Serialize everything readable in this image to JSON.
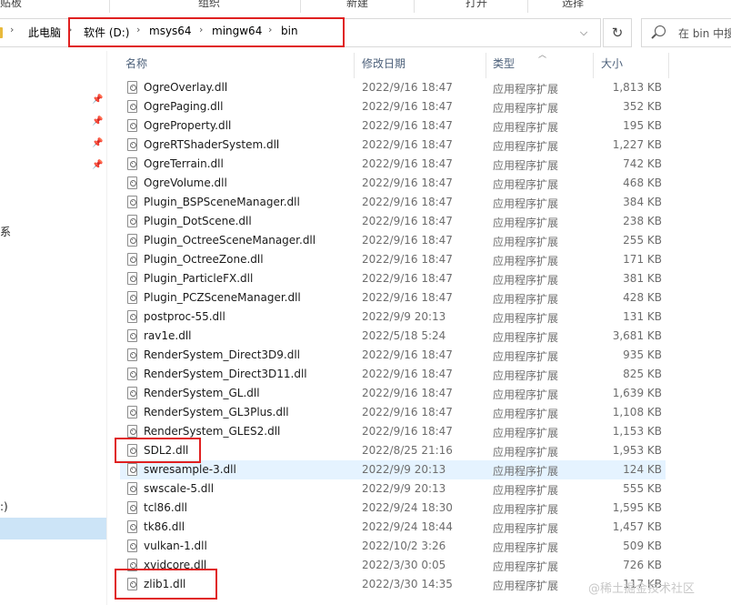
{
  "ribbon": {
    "items": [
      "贴板",
      "组织",
      "新建",
      "打开",
      "选择"
    ]
  },
  "address": {
    "crumbs": [
      "此电脑",
      "软件 (D:)",
      "msys64",
      "mingw64",
      "bin"
    ],
    "search_placeholder": "在 bin 中搜"
  },
  "nav": {
    "fragments": [
      "系",
      ":)"
    ]
  },
  "columns": {
    "name": "名称",
    "date": "修改日期",
    "type": "类型",
    "size": "大小"
  },
  "files": [
    {
      "name": "OgreOverlay.dll",
      "date": "2022/9/16 18:47",
      "type": "应用程序扩展",
      "size": "1,813 KB"
    },
    {
      "name": "OgrePaging.dll",
      "date": "2022/9/16 18:47",
      "type": "应用程序扩展",
      "size": "352 KB"
    },
    {
      "name": "OgreProperty.dll",
      "date": "2022/9/16 18:47",
      "type": "应用程序扩展",
      "size": "195 KB"
    },
    {
      "name": "OgreRTShaderSystem.dll",
      "date": "2022/9/16 18:47",
      "type": "应用程序扩展",
      "size": "1,227 KB"
    },
    {
      "name": "OgreTerrain.dll",
      "date": "2022/9/16 18:47",
      "type": "应用程序扩展",
      "size": "742 KB"
    },
    {
      "name": "OgreVolume.dll",
      "date": "2022/9/16 18:47",
      "type": "应用程序扩展",
      "size": "468 KB"
    },
    {
      "name": "Plugin_BSPSceneManager.dll",
      "date": "2022/9/16 18:47",
      "type": "应用程序扩展",
      "size": "384 KB"
    },
    {
      "name": "Plugin_DotScene.dll",
      "date": "2022/9/16 18:47",
      "type": "应用程序扩展",
      "size": "238 KB"
    },
    {
      "name": "Plugin_OctreeSceneManager.dll",
      "date": "2022/9/16 18:47",
      "type": "应用程序扩展",
      "size": "255 KB"
    },
    {
      "name": "Plugin_OctreeZone.dll",
      "date": "2022/9/16 18:47",
      "type": "应用程序扩展",
      "size": "171 KB"
    },
    {
      "name": "Plugin_ParticleFX.dll",
      "date": "2022/9/16 18:47",
      "type": "应用程序扩展",
      "size": "381 KB"
    },
    {
      "name": "Plugin_PCZSceneManager.dll",
      "date": "2022/9/16 18:47",
      "type": "应用程序扩展",
      "size": "428 KB"
    },
    {
      "name": "postproc-55.dll",
      "date": "2022/9/9 20:13",
      "type": "应用程序扩展",
      "size": "131 KB"
    },
    {
      "name": "rav1e.dll",
      "date": "2022/5/18 5:24",
      "type": "应用程序扩展",
      "size": "3,681 KB"
    },
    {
      "name": "RenderSystem_Direct3D9.dll",
      "date": "2022/9/16 18:47",
      "type": "应用程序扩展",
      "size": "935 KB"
    },
    {
      "name": "RenderSystem_Direct3D11.dll",
      "date": "2022/9/16 18:47",
      "type": "应用程序扩展",
      "size": "825 KB"
    },
    {
      "name": "RenderSystem_GL.dll",
      "date": "2022/9/16 18:47",
      "type": "应用程序扩展",
      "size": "1,639 KB"
    },
    {
      "name": "RenderSystem_GL3Plus.dll",
      "date": "2022/9/16 18:47",
      "type": "应用程序扩展",
      "size": "1,108 KB"
    },
    {
      "name": "RenderSystem_GLES2.dll",
      "date": "2022/9/16 18:47",
      "type": "应用程序扩展",
      "size": "1,153 KB"
    },
    {
      "name": "SDL2.dll",
      "date": "2022/8/25 21:16",
      "type": "应用程序扩展",
      "size": "1,953 KB"
    },
    {
      "name": "swresample-3.dll",
      "date": "2022/9/9 20:13",
      "type": "应用程序扩展",
      "size": "124 KB"
    },
    {
      "name": "swscale-5.dll",
      "date": "2022/9/9 20:13",
      "type": "应用程序扩展",
      "size": "555 KB"
    },
    {
      "name": "tcl86.dll",
      "date": "2022/9/24 18:30",
      "type": "应用程序扩展",
      "size": "1,595 KB"
    },
    {
      "name": "tk86.dll",
      "date": "2022/9/24 18:44",
      "type": "应用程序扩展",
      "size": "1,457 KB"
    },
    {
      "name": "vulkan-1.dll",
      "date": "2022/10/2 3:26",
      "type": "应用程序扩展",
      "size": "509 KB"
    },
    {
      "name": "xvidcore.dll",
      "date": "2022/3/30 0:05",
      "type": "应用程序扩展",
      "size": "726 KB"
    },
    {
      "name": "zlib1.dll",
      "date": "2022/3/30 14:35",
      "type": "应用程序扩展",
      "size": "117 KB"
    }
  ],
  "watermark": "@稀土掘金技术社区",
  "colors": {
    "highlight_border": "#e02020",
    "hover_row": "#e5f3ff",
    "nav_selected": "#cce4f7"
  }
}
